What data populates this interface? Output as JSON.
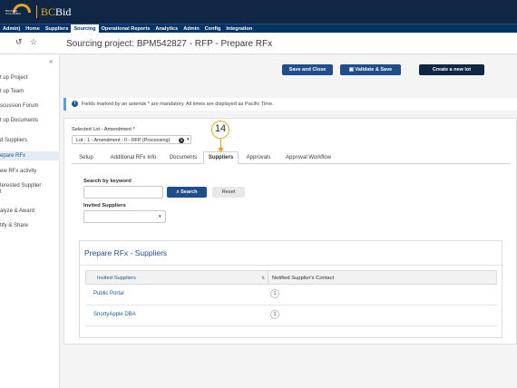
{
  "brand": {
    "logo_text": "BRITISH COLUMBIA",
    "title_bc": "BC",
    "title_bid": "Bid"
  },
  "nav": [
    "Admin)",
    "Home",
    "Suppliers",
    "Sourcing",
    "Operational Reports",
    "Analytics",
    "Admin",
    "Config",
    "Integration"
  ],
  "nav_active": "Sourcing",
  "toolbar": {
    "history_icon": "history-icon",
    "star_icon": "star-icon",
    "page_title": "Sourcing project: BPM542827 - RFP - Prepare RFx"
  },
  "sidebar": {
    "collapse_glyph": "«",
    "items": [
      {
        "label": "t up Project",
        "active": false
      },
      {
        "label": "t up Team",
        "active": false
      },
      {
        "label": "scussion Forum",
        "active": false
      },
      {
        "label": "t up Documents",
        "active": false
      },
      {
        "label": "d Suppliers",
        "active": false
      },
      {
        "label": "epare RFx",
        "active": true
      },
      {
        "label": "ew RFx activity",
        "active": false
      },
      {
        "label": "terested Supplier",
        "active": false
      },
      {
        "label": "t",
        "active": false
      },
      {
        "label": "alyze & Award",
        "active": false
      },
      {
        "label": "tify & Share",
        "active": false
      }
    ]
  },
  "actions": {
    "save_close": "Save and Close",
    "validate_save": "Validate & Save",
    "create_lot": "Create a new lot"
  },
  "info": {
    "icon": "info-icon",
    "text": "Fields marked by an asterisk * are mandatory. All times are displayed as Pacific Time."
  },
  "lot": {
    "label": "Selected Lot - Amendment *",
    "value": "Lot : 1 - Amendment : 0 - RFP (Processing)"
  },
  "tabs": [
    "Setup",
    "Additional RFx Info",
    "Documents",
    "Suppliers",
    "Approvals",
    "Approval Workflow"
  ],
  "tab_active": "Suppliers",
  "callout_number": "14",
  "search": {
    "label": "Search by keyword",
    "button": "Search",
    "reset": "Reset",
    "invited_label": "Invited Suppliers"
  },
  "panel": {
    "title": "Prepare RFx - Suppliers",
    "columns": [
      "Invited Suppliers",
      "Notified Supplier's Contact"
    ],
    "rows": [
      {
        "supplier": "Public Portal",
        "contact": "1"
      },
      {
        "supplier": "SnortyApple DBA",
        "contact": "1"
      }
    ]
  }
}
